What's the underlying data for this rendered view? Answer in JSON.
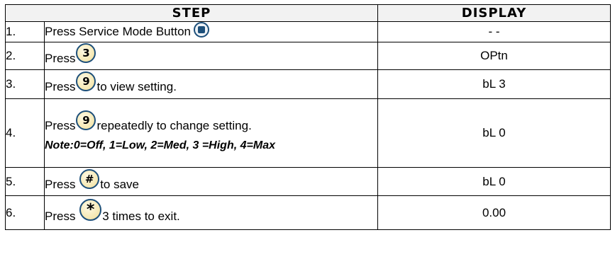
{
  "header": {
    "step": "STEP",
    "display": "DISPLAY"
  },
  "rows": [
    {
      "num": "1.",
      "pre": "Press Service Mode Button",
      "key": "service-mode-button",
      "post": "",
      "display": "- -"
    },
    {
      "num": "2.",
      "pre": "Press",
      "key": "3",
      "post": "",
      "display": "OPtn"
    },
    {
      "num": "3.",
      "pre": "Press",
      "key": "9",
      "post": "to view setting.",
      "display": "bL 3"
    },
    {
      "num": "4.",
      "pre": "Press",
      "key": "9",
      "post": "repeatedly to change setting.",
      "note": "Note:0=Off,  1=Low,  2=Med,  3 =High, 4=Max",
      "display": "bL 0"
    },
    {
      "num": "5.",
      "pre": "Press ",
      "key": "#",
      "post": "to save",
      "display": "bL 0"
    },
    {
      "num": "6.",
      "pre": "Press ",
      "key": "*",
      "post": "3 times to exit.",
      "display": "0.00"
    }
  ],
  "icons": {
    "key_border_color": "#1d4f7a",
    "key_fill_color": "#f5e7b0"
  }
}
